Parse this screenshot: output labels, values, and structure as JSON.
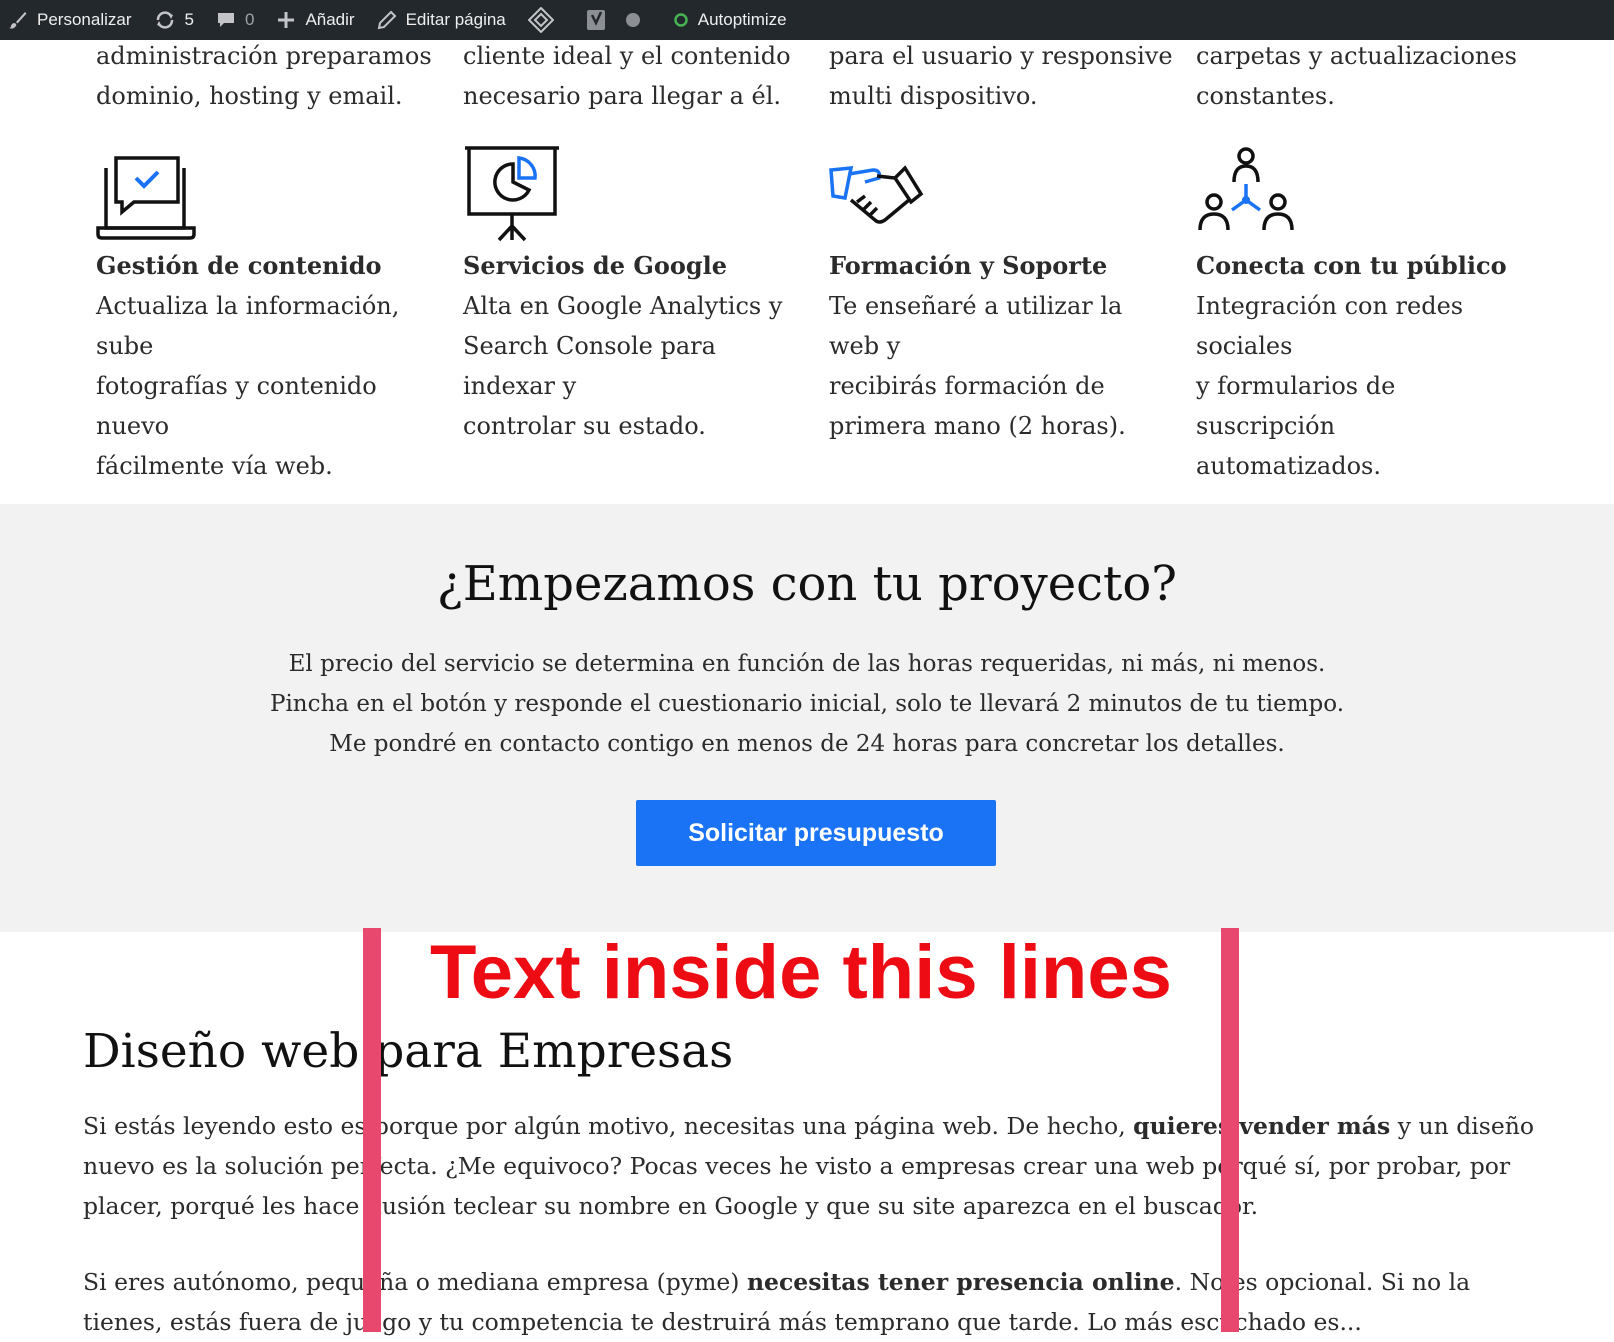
{
  "adminbar": {
    "customize": "Personalizar",
    "updates_count": "5",
    "comments_count": "0",
    "add_new": "Añadir",
    "edit_page": "Editar página",
    "autoptimize": "Autoptimize"
  },
  "top_row": [
    {
      "line1": "administración preparamos",
      "line2": "dominio, hosting y email."
    },
    {
      "line1": "cliente ideal y el contenido",
      "line2": "necesario para llegar a él."
    },
    {
      "line1": "para el usuario y responsive",
      "line2": "multi dispositivo."
    },
    {
      "line1": "carpetas y actualizaciones",
      "line2": "constantes."
    }
  ],
  "features": [
    {
      "icon": "laptop-chat-icon",
      "title": "Gestión de contenido",
      "lines": [
        "Actualiza la información, sube",
        "fotografías y contenido nuevo",
        "fácilmente vía web."
      ]
    },
    {
      "icon": "presentation-chart-icon",
      "title": "Servicios de Google",
      "lines": [
        "Alta en Google Analytics y",
        "Search Console para indexar y",
        "controlar su estado."
      ]
    },
    {
      "icon": "handshake-icon",
      "title": "Formación y Soporte",
      "lines": [
        "Te enseñaré a utilizar la web y",
        "recibirás formación de",
        "primera mano (2 horas)."
      ]
    },
    {
      "icon": "network-people-icon",
      "title": "Conecta con tu público",
      "lines": [
        "Integración con redes sociales",
        "y formularios de suscripción",
        "automatizados."
      ]
    }
  ],
  "cta": {
    "title": "¿Empezamos con tu proyecto?",
    "lines": [
      "El precio del servicio se determina en función de las horas requeridas, ni más, ni menos.",
      "Pincha en el botón y responde el cuestionario inicial, solo te llevará 2 minutos de tu tiempo.",
      "Me pondré en contacto contigo en menos de 24 horas para concretar los detalles."
    ],
    "button": "Solicitar presupuesto"
  },
  "article": {
    "title": "Diseño web para Empresas",
    "p1_a": "Si estás leyendo esto es porque por algún motivo, necesitas una página web. De hecho, ",
    "p1_bold": "quieres vender más",
    "p1_b": " y un diseño nuevo es la solución perfecta. ¿Me equivoco? Pocas veces he visto a empresas crear una web porqué sí, por probar, por placer, porqué les hace ilusión teclear su nombre en Google y que su site aparezca en el buscador.",
    "p2_a": "Si eres autónomo, pequeña o mediana empresa (pyme) ",
    "p2_bold": "necesitas tener presencia online",
    "p2_b": ". No es opcional. Si no la tienes, estás fuera de juego y tu competencia te destruirá más temprano que tarde. Lo más escuchado es..."
  },
  "annotation": {
    "text": "Text inside this lines",
    "color": "#ee0c14",
    "line_color": "#e8486e"
  },
  "colors": {
    "accent": "#1a73f5",
    "adminbar_bg": "#23282d",
    "section_bg": "#f2f2f2"
  }
}
